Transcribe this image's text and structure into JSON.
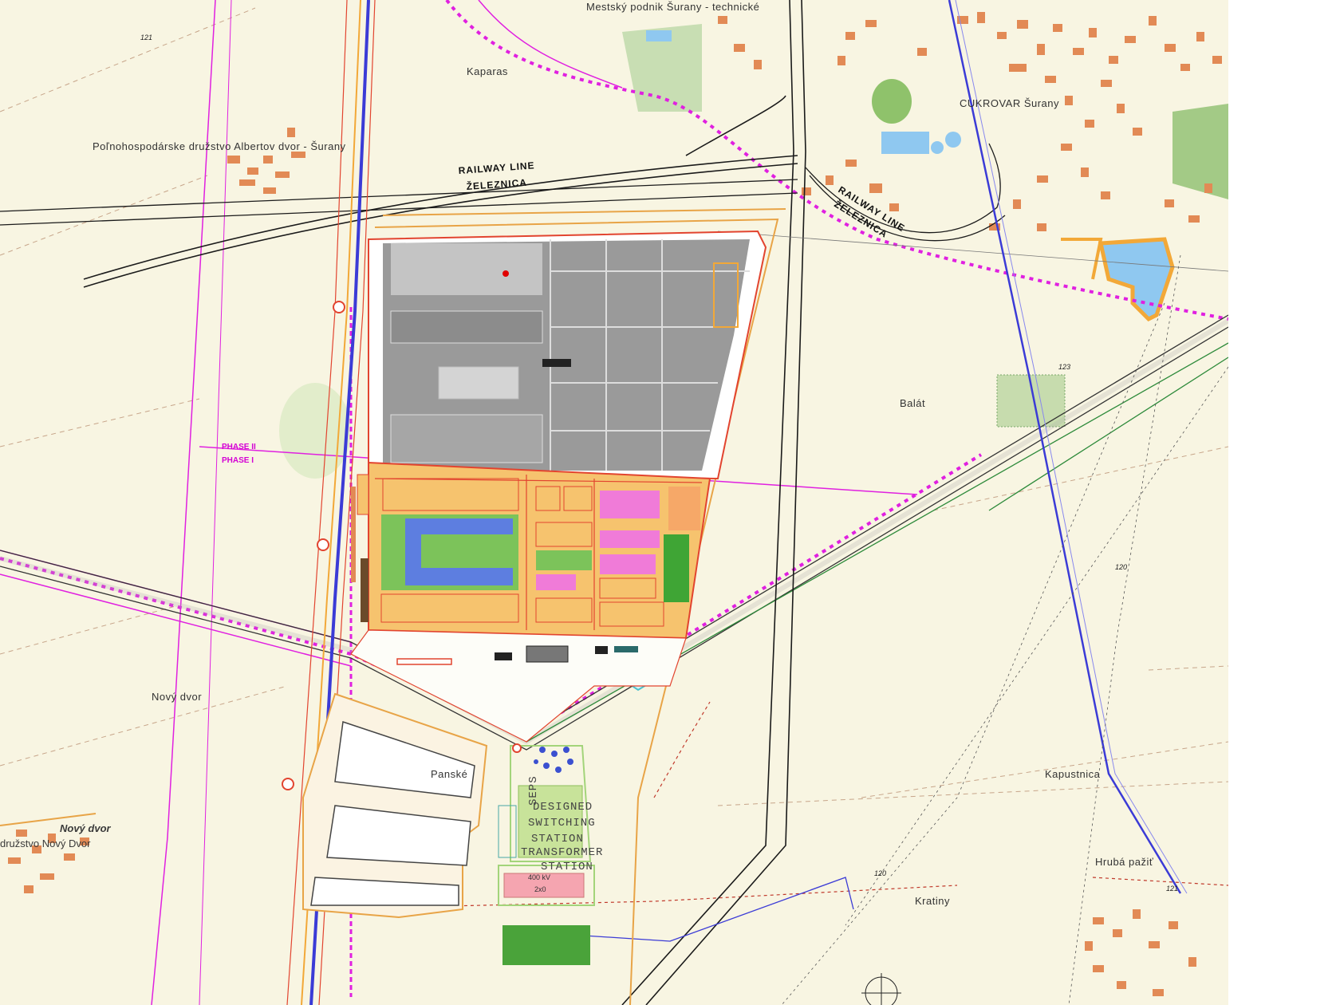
{
  "labels": {
    "mestsky_podnik": "Mestský podnik Šurany - technické",
    "kaparas": "Kaparas",
    "cukrovar": "CUKROVAR Šurany",
    "pd_albertov": "Poľnohospodárske družstvo Albertov dvor - Šurany",
    "railway_line_main": "RAILWAY LINE",
    "zeleznica_main": "ŽELEZNICA",
    "railway_line_east": "RAILWAY LINE",
    "zeleznica_east": "ŽELEZNICA",
    "balat": "Balát",
    "novy_dvor": "Nový dvor",
    "novy_dvor_village": "Nový dvor",
    "druzstvo_novy_dvor": "družstvo Nový Dvor",
    "panske": "Panské",
    "kapustnica": "Kapustnica",
    "hruba_pazit": "Hrubá pažiť",
    "kratiny": "Kratiny",
    "phase_2": "PHASE II",
    "phase_1": "PHASE I",
    "station_line1": "DESIGNED",
    "station_line2": "SWITCHING",
    "station_line3": "STATION",
    "station_line4": "TRANSFORMER",
    "station_line5": "STATION",
    "seps": "SEPS",
    "kv_label": "400 kV",
    "kv_label2": "2x0",
    "elev_121_nw": "121",
    "elev_121_se": "121",
    "elev_123": "123",
    "elev_120_e": "120",
    "elev_120_s": "120"
  },
  "colors": {
    "background": "#f8f5e2",
    "road_orange": "#e8a447",
    "road_red": "#e2442f",
    "rail_black": "#1a1a1a",
    "highway_blue": "#3b3bd6",
    "powerline_magenta": "#e020e0",
    "powerline_green": "#2d8a3a",
    "hall_grey": "#9a9a9a",
    "phase1_orange": "#f6c36e",
    "phase1_pink": "#f07bd8",
    "phase1_blue": "#5d7ee0",
    "phase1_green": "#7cc35a",
    "building_orange": "#e28a55",
    "water_blue": "#8fc8f0",
    "woods_green": "#bcd8a8"
  }
}
